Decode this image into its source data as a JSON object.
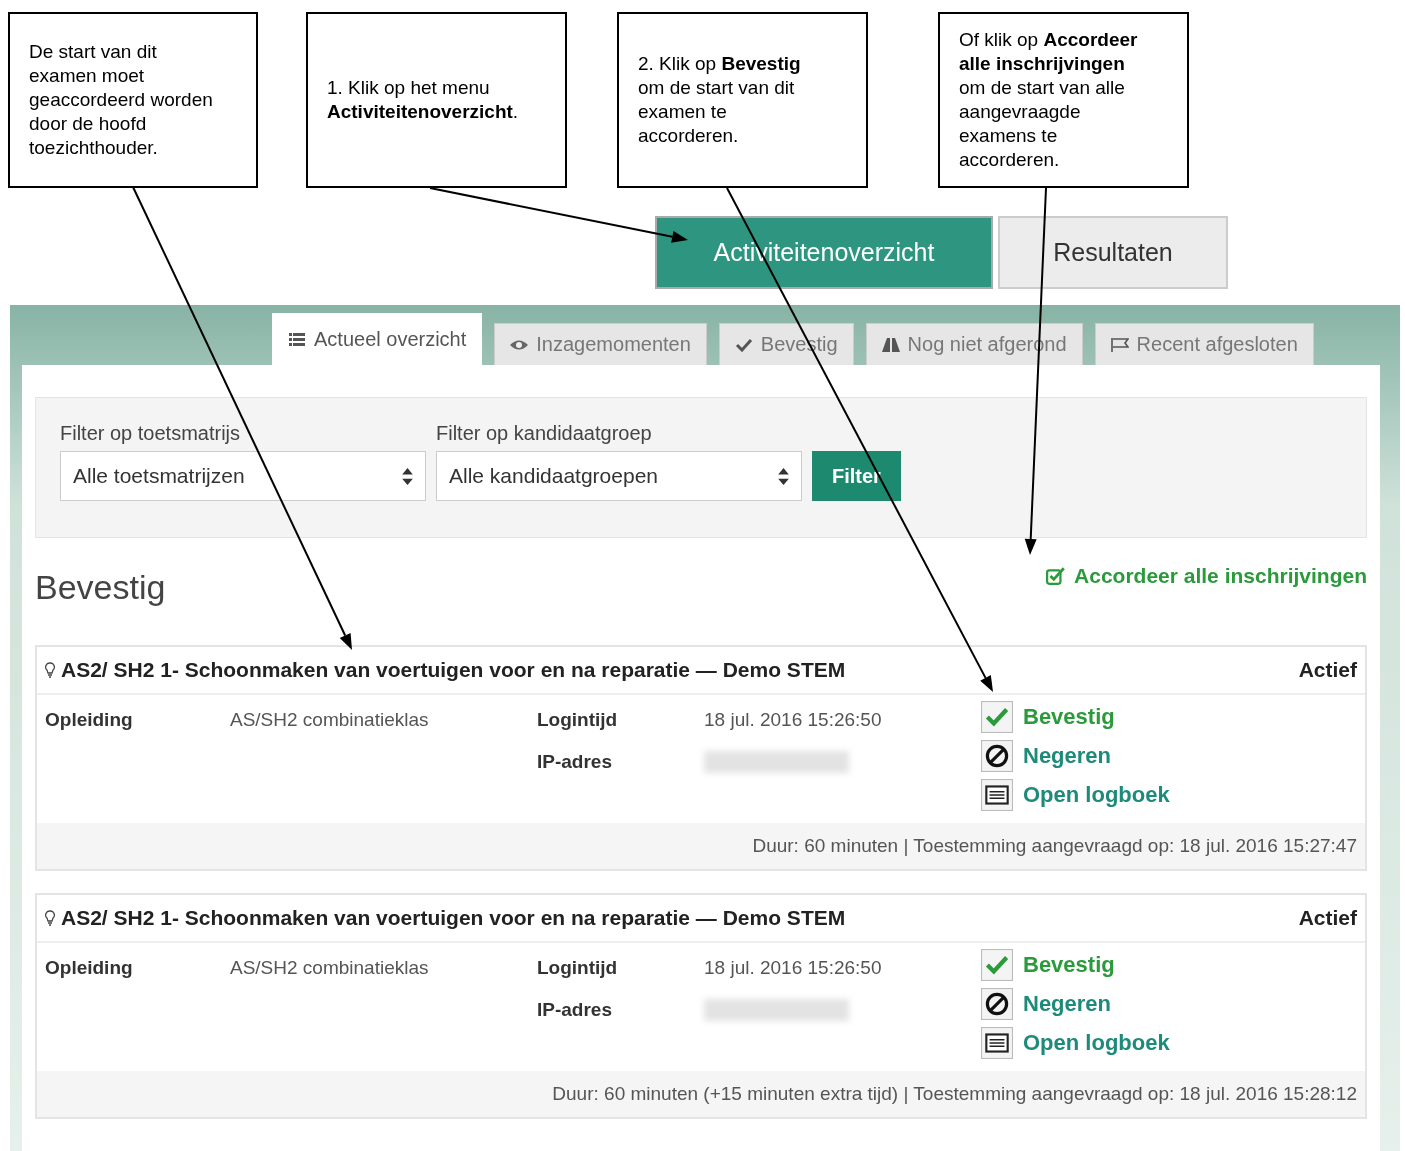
{
  "callouts": [
    "De start van dit examen moet geaccordeerd worden door de hoofd toezichthouder.",
    "1. Klik op het menu **Activiteitenoverzicht**.",
    "2. Klik op **Bevestig** om de start van dit examen te accorderen.",
    "Of klik op **Accordeer alle inschrijvingen** om de start van alle aangevraagde examens te accorderen."
  ],
  "menu": [
    {
      "label": "Activiteitenoverzicht",
      "selected": true
    },
    {
      "label": "Resultaten",
      "selected": false
    }
  ],
  "tabs": [
    {
      "label": "Actueel overzicht",
      "kind": "list",
      "selected": true
    },
    {
      "label": "Inzagemomenten",
      "kind": "eye",
      "selected": false
    },
    {
      "label": "Bevestig",
      "kind": "check",
      "selected": false
    },
    {
      "label": "Nog niet afgerond",
      "kind": "road",
      "selected": false
    },
    {
      "label": "Recent afgesloten",
      "kind": "flag",
      "selected": false
    }
  ],
  "filters": [
    {
      "label": "Filter op toetsmatrijs",
      "value": "Alle toetsmatrijzen"
    },
    {
      "label": "Filter op kandidaatgroep",
      "value": "Alle kandidaatgroepen"
    }
  ],
  "filter_button": "Filter",
  "section_title": "Bevestig",
  "approve_all": "Accordeer alle inschrijvingen",
  "entries": [
    {
      "title": "AS2/ SH2 1- Schoonmaken van voertuigen voor en na reparatie — Demo STEM",
      "status": "Actief",
      "program_label": "Opleiding",
      "program": "AS/SH2 combinatieklas",
      "login_label": "Logintijd",
      "login": "18 jul. 2016 15:26:50",
      "ip_label": "IP-adres",
      "actions": [
        {
          "label": "Bevestig",
          "kind": "confirm"
        },
        {
          "label": "Negeren",
          "kind": "ignore"
        },
        {
          "label": "Open logboek",
          "kind": "log"
        }
      ],
      "footer": "Duur: 60 minuten | Toestemming aangevraagd op: 18 jul. 2016 15:27:47"
    },
    {
      "title": "AS2/ SH2 1- Schoonmaken van voertuigen voor en na reparatie — Demo STEM",
      "status": "Actief",
      "program_label": "Opleiding",
      "program": "AS/SH2 combinatieklas",
      "login_label": "Logintijd",
      "login": "18 jul. 2016 15:26:50",
      "ip_label": "IP-adres",
      "actions": [
        {
          "label": "Bevestig",
          "kind": "confirm"
        },
        {
          "label": "Negeren",
          "kind": "ignore"
        },
        {
          "label": "Open logboek",
          "kind": "log"
        }
      ],
      "footer": "Duur: 60 minuten (+15 minuten extra tijd) | Toestemming aangevraagd op: 18 jul. 2016 15:28:12"
    }
  ]
}
